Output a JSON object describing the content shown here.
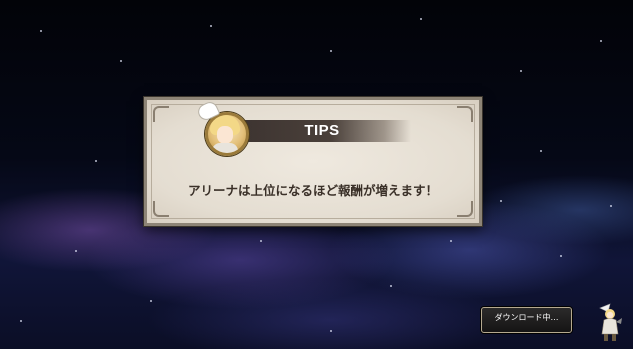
{
  "tips": {
    "title": "TIPS",
    "message": "アリーナは上位になるほど報酬が増えます！"
  },
  "download": {
    "status_text": "ダウンロード中…"
  },
  "colors": {
    "panel_background": "#e9e2d7",
    "panel_border": "#8d8476",
    "title_bar": "#3c3330",
    "message_text": "#3a3028",
    "background_top": "#020308",
    "background_bottom": "#101538"
  },
  "icons": {
    "avatar": "character-portrait-icon",
    "loading": "loading-character-icon"
  }
}
